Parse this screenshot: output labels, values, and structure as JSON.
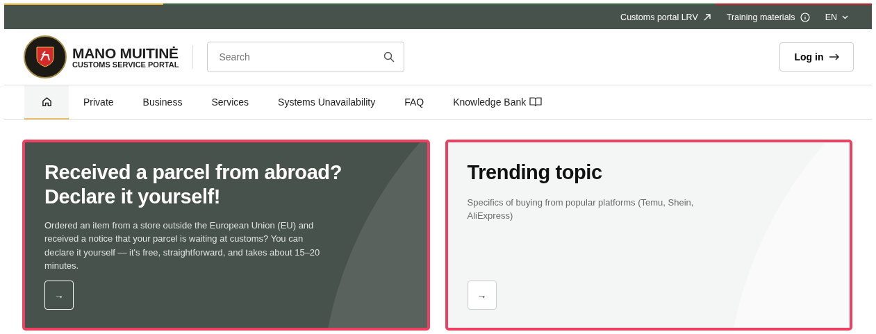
{
  "top_bar": {
    "links": [
      {
        "label": "Customs portal LRV",
        "kind": "external"
      },
      {
        "label": "Training materials",
        "kind": "info"
      }
    ],
    "language": "EN"
  },
  "header": {
    "title": "MANO MUITINĖ",
    "subtitle": "CUSTOMS SERVICE PORTAL",
    "search": {
      "placeholder": "Search"
    },
    "login": "Log in"
  },
  "nav": [
    {
      "kind": "home",
      "selected": true
    },
    {
      "kind": "text",
      "label": "Private",
      "selected": false
    },
    {
      "kind": "text",
      "label": "Business",
      "selected": false
    },
    {
      "kind": "text",
      "label": "Services",
      "selected": false
    },
    {
      "kind": "text",
      "label": "Systems Unavailability",
      "selected": false
    },
    {
      "kind": "text",
      "label": "FAQ",
      "selected": false
    },
    {
      "kind": "book",
      "label": "Knowledge Bank",
      "selected": false
    }
  ],
  "cards": [
    {
      "kind": "dark",
      "title": "Received a parcel from abroad? Declare it yourself!",
      "text": "Ordered an item from a store outside the European Union (EU) and received a notice that your parcel is waiting at customs? You can declare it yourself — it's free, straightforward, and takes about 15–20 minutes.",
      "button": "→"
    },
    {
      "kind": "light",
      "title": "Trending topic",
      "text": "Specifics of buying from popular platforms (Temu, Shein, AliExpress)",
      "button": "→"
    }
  ]
}
